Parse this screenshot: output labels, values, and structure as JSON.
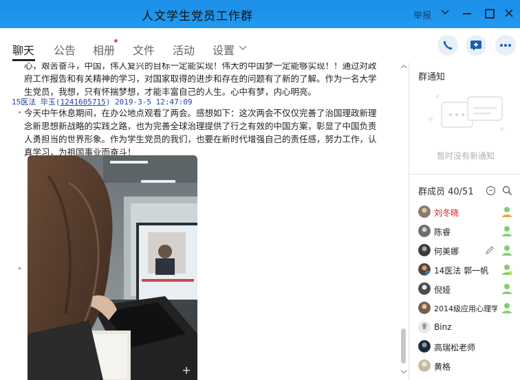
{
  "window": {
    "title": "人文学生党员工作群",
    "report_label": "举报"
  },
  "tabs": [
    {
      "label": "聊天",
      "active": true
    },
    {
      "label": "公告"
    },
    {
      "label": "相册",
      "has_new_dot": true
    },
    {
      "label": "文件"
    },
    {
      "label": "活动"
    },
    {
      "label": "设置"
    }
  ],
  "toolbar_icons": [
    "phone-icon",
    "add-app-icon",
    "more-icon"
  ],
  "chat": {
    "prev_message_lines": [
      "心，艰苦奋斗，中国，伟人复兴的目标一定能实现！伟大的中国梦一定能够实现！！通过对政",
      "府工作报告和有关精神的学习，对国家取得的进步和存在的问题有了新的了解。作为一名大学",
      "生党员，我想，只有怀揣梦想，才能丰富自己的人生。心中有梦，内心明亮。"
    ],
    "message": {
      "sender_name": "15医法 毕玉",
      "sender_id": "1241605715",
      "timestamp": "2019-3-5 12:47:09",
      "lines": [
        "今天中午休息期间，在办公地点观看了两会。感想如下：这次两会不仅仅完善了治国理政新理",
        "念新思想新战略的实践之路，也为完善全球治理提供了行之有效的中国方案，彰显了中国负责",
        "人勇担当的世界形象。作为学生党员的我们，也要在新时代增强自己的责任感，努力工作，认",
        "真学习，为祖国事业而奋斗！"
      ]
    }
  },
  "sidebar": {
    "notice_title": "群通知",
    "notice_empty": "暂时没有新通知",
    "members_title": "群成员 40/51",
    "members": [
      {
        "name": "刘冬晓",
        "owner": true,
        "avatar_color": "#8a7a6a",
        "icon": "admin-icon"
      },
      {
        "name": "陈睿",
        "avatar_color": "#6d6d6d",
        "icon": "member-icon"
      },
      {
        "name": "何美娜",
        "avatar_color": "#3b3b3b",
        "icon": "member-icon",
        "edit_icon": true
      },
      {
        "name": "14医法 郭一帆",
        "avatar_color": "#5a4636",
        "icon": "member-star-icon"
      },
      {
        "name": "倪娅",
        "avatar_color": "#4b4b4b",
        "icon": "member-icon"
      },
      {
        "name": "2014级应用心理学",
        "avatar_color": "#7b5e4a",
        "icon": "member-icon"
      },
      {
        "name": "Binz",
        "avatar_color": "#e8e8e8"
      },
      {
        "name": "高瑞松老师",
        "avatar_color": "#1e2a36"
      },
      {
        "name": "黄格",
        "avatar_color": "#c9b8a4"
      }
    ]
  }
}
